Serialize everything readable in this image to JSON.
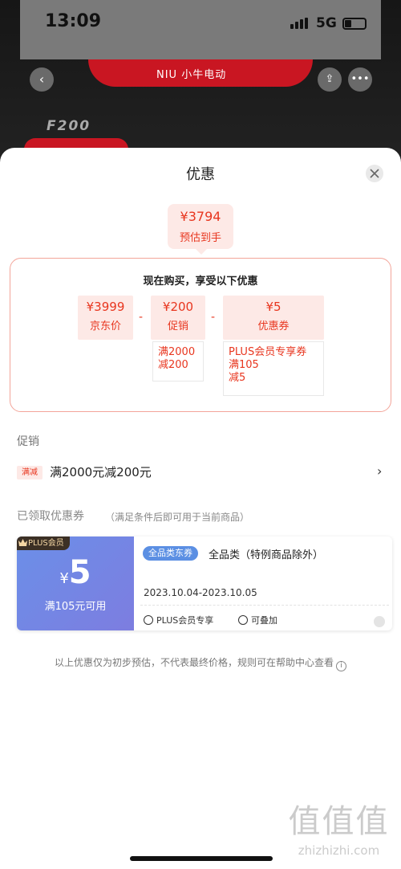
{
  "status_bar": {
    "time": "13:09",
    "network": "5G"
  },
  "header": {
    "brand": "NIU 小牛电动",
    "model": "F200"
  },
  "sheet": {
    "title": "优惠",
    "estimate": {
      "price": "¥3794",
      "label": "预估到手"
    },
    "breakdown": {
      "title": "现在购买，享受以下优惠",
      "jd_price": {
        "value": "¥3999",
        "label": "京东价"
      },
      "promo": {
        "value": "¥200",
        "label": "促销",
        "detail": [
          "满2000",
          "减200"
        ]
      },
      "coupon": {
        "value": "¥5",
        "label": "优惠券",
        "detail": [
          "PLUS会员专享券",
          "满105",
          "减5"
        ]
      },
      "minus": "-"
    },
    "promotions": {
      "title": "促销",
      "tag": "满减",
      "text": "满2000元减200元"
    },
    "coupons": {
      "title": "已领取优惠券",
      "note": "（满足条件后即可用于当前商品）",
      "items": [
        {
          "badge": "PLUS会员",
          "currency": "¥",
          "amount": "5",
          "condition": "满105元可用",
          "type": "全品类东券",
          "name": "全品类（特例商品除外）",
          "date": "2023.10.04-2023.10.05",
          "tag1": "PLUS会员专享",
          "tag2": "可叠加"
        }
      ]
    },
    "footnote": "以上优惠仅为初步预估，不代表最终价格，规则可在帮助中心查看",
    "watermark": {
      "big": "值值值",
      "small": "zhizhizhi.com"
    }
  },
  "colors": {
    "accent": "#e8361f",
    "chip_bg": "#fde9e6",
    "coupon_blue": "#6b8fe8"
  },
  "icons": [
    "back-icon",
    "share-icon",
    "more-icon",
    "close-icon",
    "chevron-right-icon",
    "crown-icon",
    "info-icon"
  ]
}
